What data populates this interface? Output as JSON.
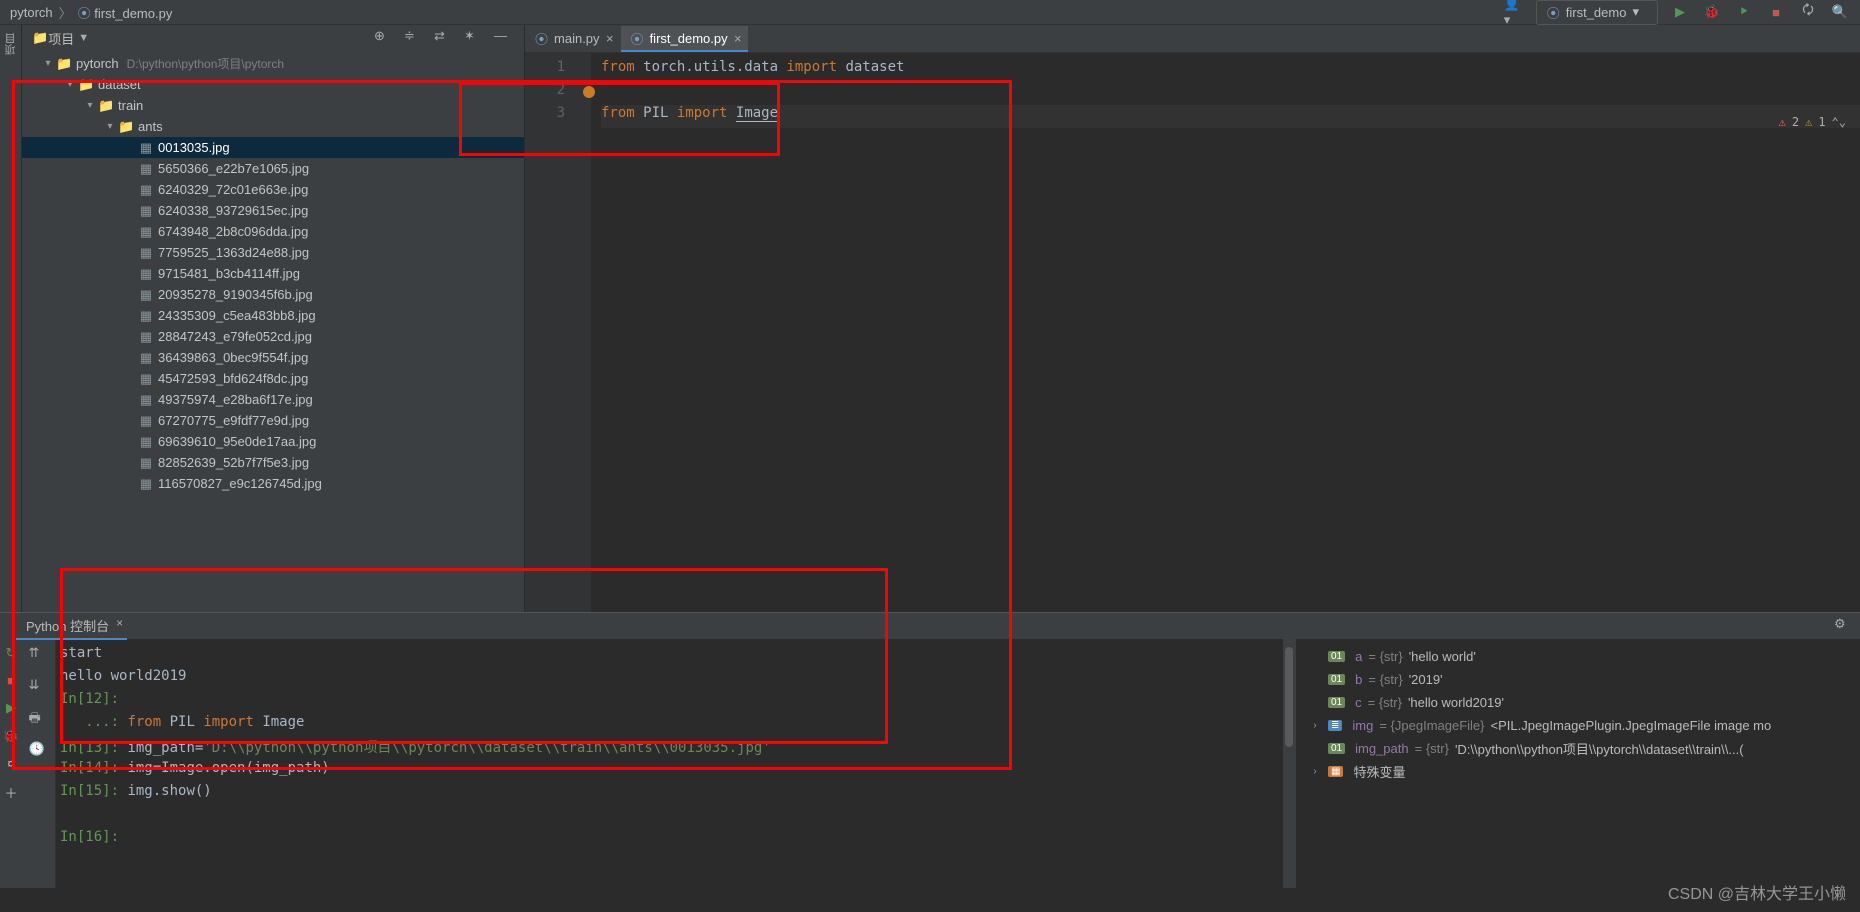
{
  "crumbs": {
    "root": "pytorch",
    "file": "first_demo.py"
  },
  "runconfig": {
    "label": "first_demo"
  },
  "proj_hdr": "项目",
  "tree": {
    "root_name": "pytorch",
    "root_path": "D:\\python\\python项目\\pytorch",
    "dataset": "dataset",
    "train": "train",
    "ants": "ants",
    "files": [
      "0013035.jpg",
      "5650366_e22b7e1065.jpg",
      "6240329_72c01e663e.jpg",
      "6240338_93729615ec.jpg",
      "6743948_2b8c096dda.jpg",
      "7759525_1363d24e88.jpg",
      "9715481_b3cb4114ff.jpg",
      "20935278_9190345f6b.jpg",
      "24335309_c5ea483bb8.jpg",
      "28847243_e79fe052cd.jpg",
      "36439863_0bec9f554f.jpg",
      "45472593_bfd624f8dc.jpg",
      "49375974_e28ba6f17e.jpg",
      "67270775_e9fdf77e9d.jpg",
      "69639610_95e0de17aa.jpg",
      "82852639_52b7f7f5e3.jpg",
      "116570827_e9c126745d.jpg"
    ]
  },
  "tabs": [
    {
      "label": "main.py",
      "active": false
    },
    {
      "label": "first_demo.py",
      "active": true
    }
  ],
  "code": {
    "line1_kw_from": "from",
    "line1_mod": " torch.utils.data ",
    "line1_kw_import": "import",
    "line1_sym": " dataset",
    "line3_kw_from": "from",
    "line3_mod": " PIL ",
    "line3_kw_import": "import",
    "line3_sym": "Image",
    "gutter": [
      "1",
      "2",
      "3"
    ]
  },
  "badges": {
    "err": "2",
    "warn": "1"
  },
  "console": {
    "tab": "Python 控制台",
    "lines": {
      "start": "start",
      "hello": "hello world2019",
      "in12": "In[12]:",
      "cont": "   ...: ",
      "cont_kw_from": "from",
      "cont_mod": " PIL ",
      "cont_kw_import": "import",
      "cont_sym": " Image",
      "in13": "In[13]:",
      "l13": " img_path=",
      "l13str": "'D:\\\\python\\\\python项目\\\\pytorch\\\\dataset\\\\train\\\\ants\\\\0013035.jpg'",
      "in14": "In[14]:",
      "l14": " img=Image.open(img_path)",
      "in15": "In[15]:",
      "l15": " img.show()",
      "in16": "In[16]:"
    }
  },
  "vars": {
    "a_name": "a",
    "a_type": " = {str} ",
    "a_val": "'hello world'",
    "b_name": "b",
    "b_type": " = {str} ",
    "b_val": "'2019'",
    "c_name": "c",
    "c_type": " = {str} ",
    "c_val": "'hello world2019'",
    "img_name": "img",
    "img_type": " = {JpegImageFile} ",
    "img_val": "<PIL.JpegImagePlugin.JpegImageFile image mo",
    "path_name": "img_path",
    "path_type": " = {str} ",
    "path_val": "'D:\\\\python\\\\python项目\\\\pytorch\\\\dataset\\\\train\\\\...(",
    "special": "特殊变量"
  },
  "watermark": "CSDN @吉林大学王小懒"
}
